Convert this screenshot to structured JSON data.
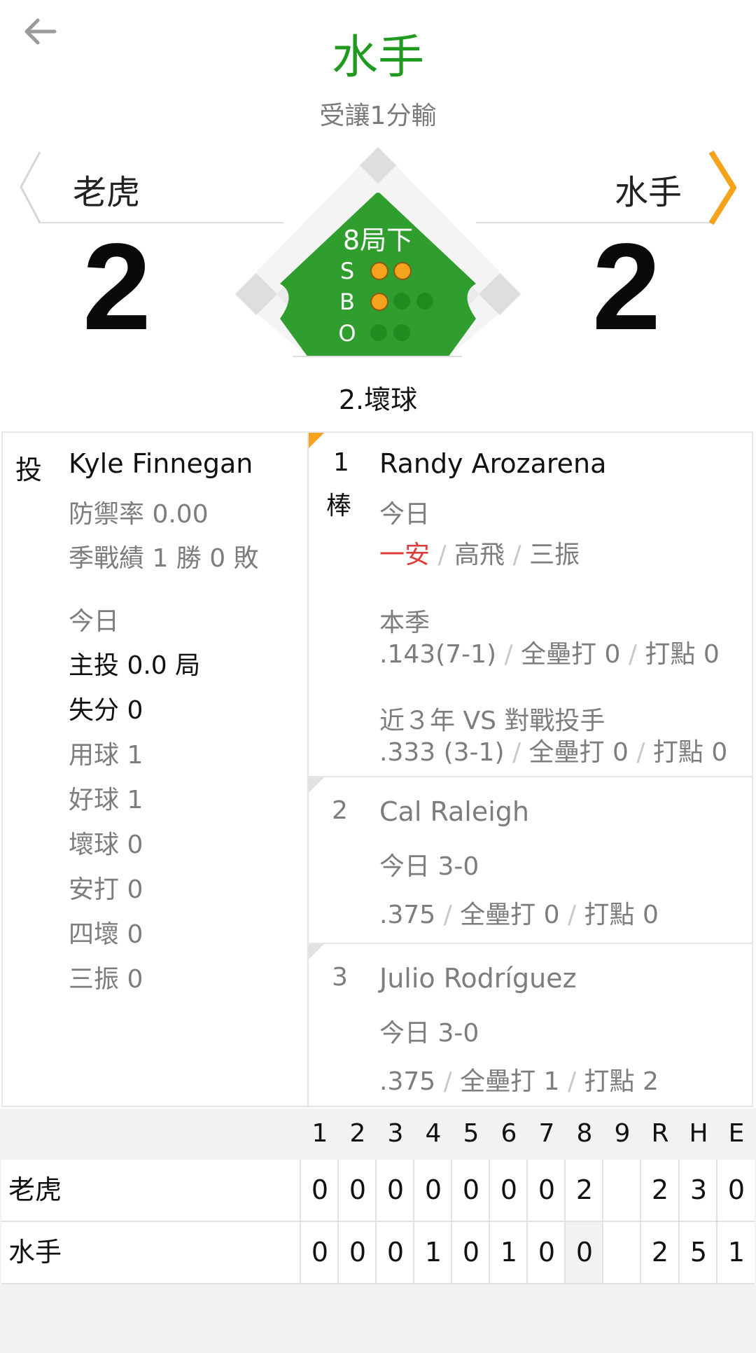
{
  "header": {
    "title": "水手",
    "subtitle": "受讓1分輸",
    "back_icon": "arrow-left-icon"
  },
  "colors": {
    "accent_green": "#1f9a1f",
    "field_green": "#2f9e2f",
    "ball_on": "#f5a21c",
    "hit_red": "#e03b3b",
    "next_arrow": "#f5a21c"
  },
  "scoreboard": {
    "away_team": "老虎",
    "home_team": "水手",
    "away_score": "2",
    "home_score": "2",
    "inning": "8局下",
    "strikes": 2,
    "balls": 1,
    "outs": 0,
    "labels": {
      "s": "S",
      "b": "B",
      "o": "O"
    },
    "play_desc": "2.壞球"
  },
  "pitcher": {
    "role": "投",
    "name": "Kyle Finnegan",
    "era": "防禦率 0.00",
    "record": "季戰績 1 勝 0 敗",
    "today_label": "今日",
    "stats": [
      {
        "text": "主投 0.0 局",
        "emph": true
      },
      {
        "text": "失分 0",
        "emph": true
      },
      {
        "text": "用球 1",
        "emph": false
      },
      {
        "text": "好球 1",
        "emph": false
      },
      {
        "text": "壞球 0",
        "emph": false
      },
      {
        "text": "安打 0",
        "emph": false
      },
      {
        "text": "四壞 0",
        "emph": false
      },
      {
        "text": "三振 0",
        "emph": false
      }
    ]
  },
  "batters": [
    {
      "order": "1",
      "order_suffix": "棒",
      "name": "Randy Arozarena",
      "today_label": "今日",
      "today_results": [
        "一安",
        "高飛",
        "三振"
      ],
      "season_label": "本季",
      "season_line": [
        ".143(7-1)",
        "全壘打 0",
        "打點 0"
      ],
      "vs_label": "近３年 VS 對戰投手",
      "vs_line": [
        ".333 (3-1)",
        "全壘打 0",
        "打點 0"
      ]
    },
    {
      "order": "2",
      "name": "Cal Raleigh",
      "today": "今日 3-0",
      "season_line": [
        ".375",
        "全壘打 0",
        "打點 0"
      ]
    },
    {
      "order": "3",
      "name": "Julio Rodríguez",
      "today": "今日 3-0",
      "season_line": [
        ".375",
        "全壘打 1",
        "打點 2"
      ]
    }
  ],
  "linescore": {
    "headers": [
      "1",
      "2",
      "3",
      "4",
      "5",
      "6",
      "7",
      "8",
      "9",
      "R",
      "H",
      "E"
    ],
    "rows": [
      {
        "team": "老虎",
        "innings": [
          "0",
          "0",
          "0",
          "0",
          "0",
          "0",
          "0",
          "2",
          ""
        ],
        "r": "2",
        "h": "3",
        "e": "0"
      },
      {
        "team": "水手",
        "innings": [
          "0",
          "0",
          "0",
          "1",
          "0",
          "1",
          "0",
          "0",
          ""
        ],
        "r": "2",
        "h": "5",
        "e": "1"
      }
    ]
  }
}
